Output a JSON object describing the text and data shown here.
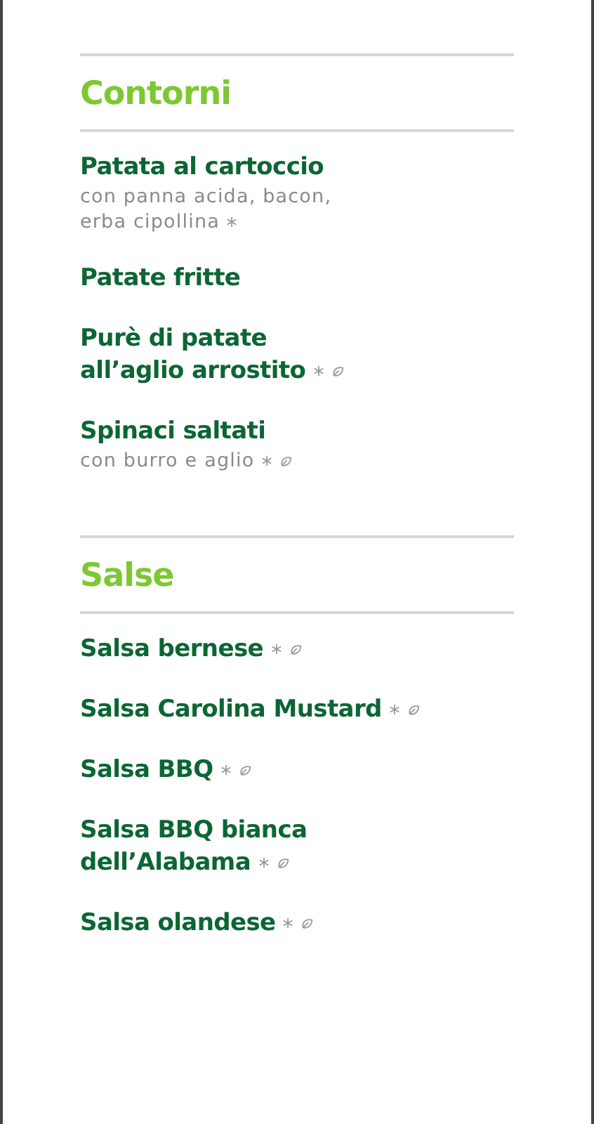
{
  "sections": [
    {
      "title": "Contorni",
      "items": [
        {
          "name": "Patata al cartoccio",
          "description": "con panna acida, bacon,\nerba cipollina",
          "snowflake": true,
          "leaf": false
        },
        {
          "name": "Patate fritte",
          "snowflake": false,
          "leaf": false
        },
        {
          "name": "Purè di patate\nall’aglio arrostito",
          "snowflake": true,
          "leaf": true
        },
        {
          "name": "Spinaci saltati",
          "description": "con burro e aglio",
          "snowflake": true,
          "leaf": true
        }
      ]
    },
    {
      "title": "Salse",
      "items": [
        {
          "name": "Salsa bernese",
          "snowflake": true,
          "leaf": true
        },
        {
          "name": "Salsa Carolina Mustard",
          "snowflake": true,
          "leaf": true
        },
        {
          "name": "Salsa BBQ",
          "snowflake": true,
          "leaf": true
        },
        {
          "name": "Salsa BBQ bianca\ndell’Alabama",
          "snowflake": true,
          "leaf": true
        },
        {
          "name": "Salsa olandese",
          "snowflake": true,
          "leaf": true
        }
      ]
    }
  ]
}
